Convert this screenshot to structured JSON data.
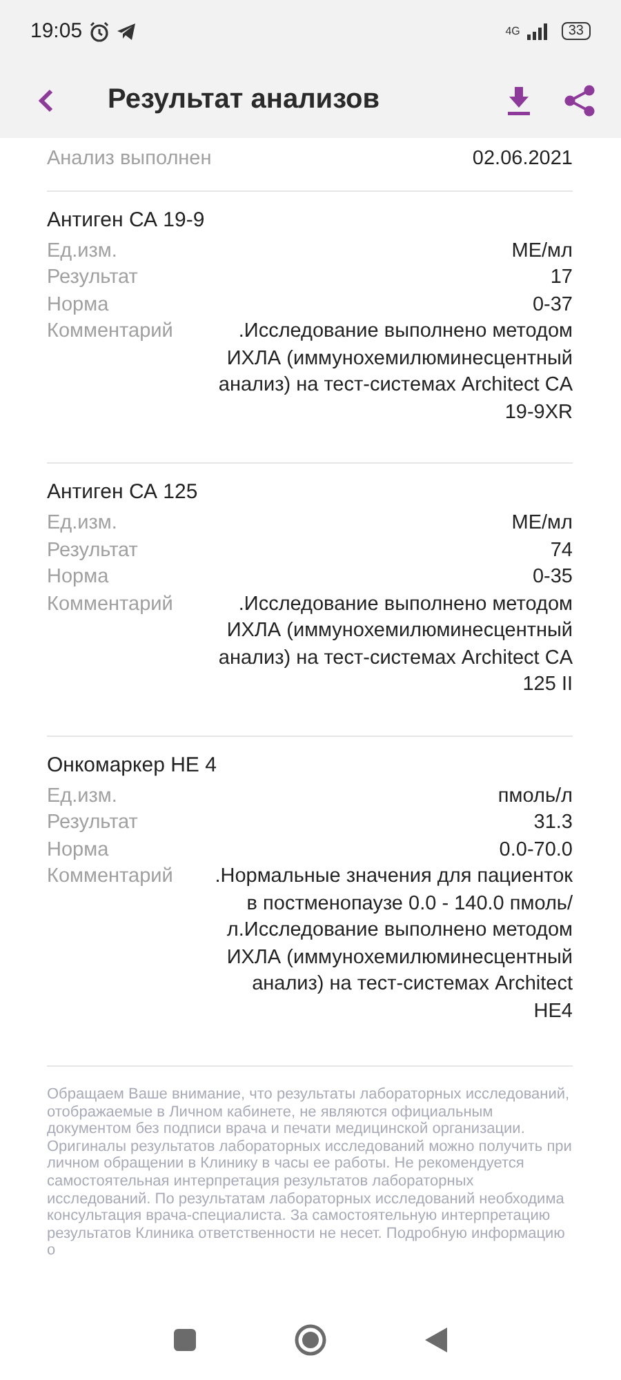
{
  "status_bar": {
    "time": "19:05",
    "network": "4G",
    "battery": "33"
  },
  "header": {
    "title": "Результат анализов"
  },
  "meta": [
    {
      "label": "Анализ выполнен",
      "value": "02.06.2021"
    }
  ],
  "tests": [
    {
      "title": "Антиген СА 19-9",
      "rows": [
        {
          "label": "Ед.изм.",
          "value": "МЕ/мл"
        },
        {
          "label": "Результат",
          "value": "17"
        },
        {
          "label": "Норма",
          "value": "0-37"
        },
        {
          "label": "Комментарий",
          "value": ".Исследование выполнено методом ИХЛА (иммунохемилюминесцентный анализ) на тест-системах Architect CA 19-9XR"
        }
      ]
    },
    {
      "title": "Антиген СА 125",
      "rows": [
        {
          "label": "Ед.изм.",
          "value": "МЕ/мл"
        },
        {
          "label": "Результат",
          "value": "74"
        },
        {
          "label": "Норма",
          "value": "0-35"
        },
        {
          "label": "Комментарий",
          "value": ".Исследование выполнено методом ИХЛА (иммунохемилюминесцентный анализ) на тест-системах Architect CA 125 II"
        }
      ]
    },
    {
      "title": "Онкомаркер  НЕ 4",
      "rows": [
        {
          "label": "Ед.изм.",
          "value": "пмоль/л"
        },
        {
          "label": "Результат",
          "value": "31.3"
        },
        {
          "label": "Норма",
          "value": "0.0-70.0"
        },
        {
          "label": "Комментарий",
          "value": ".Нормальные значения для пациенток в постменопаузе 0.0 - 140.0 пмоль/л.Исследование выполнено методом ИХЛА (иммунохемилюминесцентный анализ) на тест-системах Architect HE4"
        }
      ]
    }
  ],
  "disclaimer": "Обращаем Ваше внимание, что  результаты лабораторных исследований, отображаемые в Личном кабинете, не являются официальным документом без подписи врача и печати медицинской организации. Оригиналы результатов лабораторных исследований можно получить при личном обращении в Клинику в часы ее работы. Не рекомендуется самостоятельная интерпретация результатов лабораторных исследований. По результатам  лабораторных исследований необходима консультация врача-специалиста. За самостоятельную интерпретацию результатов Клиника ответственности не несет. Подробную информацию о"
}
